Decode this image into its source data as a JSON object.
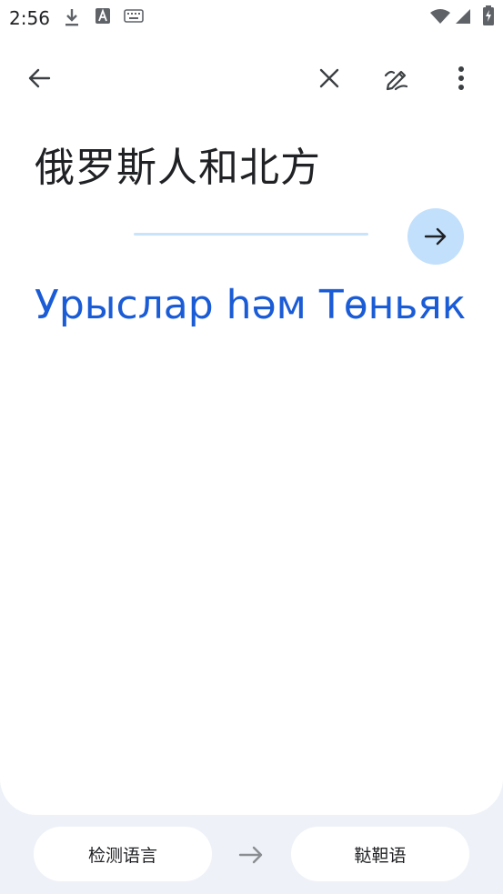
{
  "status_bar": {
    "time": "2:56",
    "icons": [
      "download-icon",
      "a-box-icon",
      "keyboard-icon",
      "wifi-icon",
      "signal-icon",
      "battery-charging-icon"
    ]
  },
  "toolbar": {
    "icons": [
      "back-arrow-icon",
      "close-icon",
      "handwriting-icon",
      "more-vert-icon"
    ]
  },
  "input": {
    "source_text": "俄罗斯人和北方"
  },
  "output": {
    "translation": "Урыслар һәм Төньяк"
  },
  "language_bar": {
    "source_language": "检测语言",
    "target_language": "鞑靼语"
  },
  "colors": {
    "accent": "#1a5bd6",
    "go_button_bg": "#c2e0fb",
    "progress_track": "#c9e3fb",
    "page_bg": "#eef2f8"
  }
}
